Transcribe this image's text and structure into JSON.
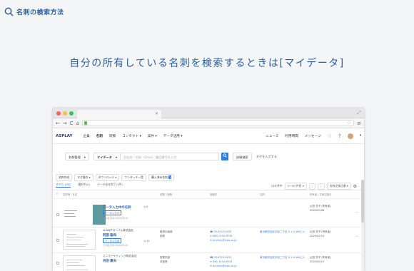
{
  "help": {
    "title": "名刺の検索方法"
  },
  "headline": "自分の所有している名刺を検索するときは[マイデータ]",
  "browser": {
    "traffic_colors": [
      "#fc605c",
      "#fdbc40",
      "#34c84a"
    ],
    "tab_close": "×",
    "expand": "⤢",
    "nav_back": "←",
    "nav_forward": "→",
    "nav_reload": "C",
    "nav_home": "⌂",
    "star": "☆",
    "menu": "≡"
  },
  "app": {
    "logo": "ASPLAY",
    "nav": [
      "企業",
      "名刺",
      "同僚",
      "コンタクト ▾",
      "案件 ▾",
      "データ活用 ▾"
    ],
    "right_links": [
      "ニュース",
      "利用時間",
      "メッセージ"
    ],
    "icons": {
      "bell": "♢",
      "help": "?",
      "caret": "▾"
    }
  },
  "search": {
    "type_select": "名刺管理",
    "scope_select": "マイデータ",
    "caret": "▾",
    "placeholder": "会社名・名前・Email・電話番号を入力",
    "detail_button": "詳細検索",
    "tag_select": "タグを入力する"
  },
  "toolbar": {
    "buttons": [
      "名刺作成",
      "タグ操作 ▾",
      "ダウンロード ▾",
      "ワンタッチ一覧",
      "購入済み名刺"
    ],
    "badge": "1"
  },
  "tabs": {
    "items": [
      "すべて(158)",
      "選択中(0)",
      "データ化未完了(1件)"
    ]
  },
  "pager": {
    "count": "158 件中",
    "range": "1〜30 件目 ▾",
    "prev": "‹",
    "next": "›",
    "sort": "名刺交換日順 ▾"
  },
  "columns": {
    "name": "名前等 / 社名",
    "dept": "部署 / 役職",
    "phone": "連絡先",
    "address": "住所",
    "owner": "所有者 / 名刺交換日"
  },
  "rows": [
    {
      "name": "データ入力中の名刺",
      "company": "",
      "pill": "データ入力中",
      "meta": "入力者 田中 2020/03/10",
      "count": "◷ 0",
      "dept": "",
      "role": "",
      "phone": "",
      "fax": "",
      "email": "",
      "address": "",
      "owner": "山田 花子 (所有者)",
      "date": "2020/03/06"
    },
    {
      "name": "阿部 聡和",
      "company": "LCANグローバル株式会社",
      "pill": "データ入力済",
      "meta": "入力者 田中 2020/02/15",
      "count": "◷ 11",
      "dept": "経営企画部",
      "role": "部長",
      "phone": "☎ 03-6723-0033",
      "fax": "✆ 080-1234-5678",
      "email": "✉ dummy@lcan.co.jp",
      "address": "東京都渋谷区渋谷二丁目 9-1 LCANビル",
      "owner": "山田 花子 (所有者)",
      "date": "2020/02/14"
    },
    {
      "name": "内田 康夫",
      "company": "ミニマーケティング株式会社",
      "pill": "",
      "meta": "",
      "count": "",
      "dept": "営業本部",
      "role": "本部長",
      "phone": "☎ 03-6723-0033",
      "fax": "✆ 080-1234-5678",
      "email": "✉ dummy@lcan.co.jp",
      "address": "東京都渋谷区渋谷二丁目 9-1 LCANビル",
      "owner": "山田 花子 (所有者)",
      "date": "2020/02/13"
    }
  ]
}
